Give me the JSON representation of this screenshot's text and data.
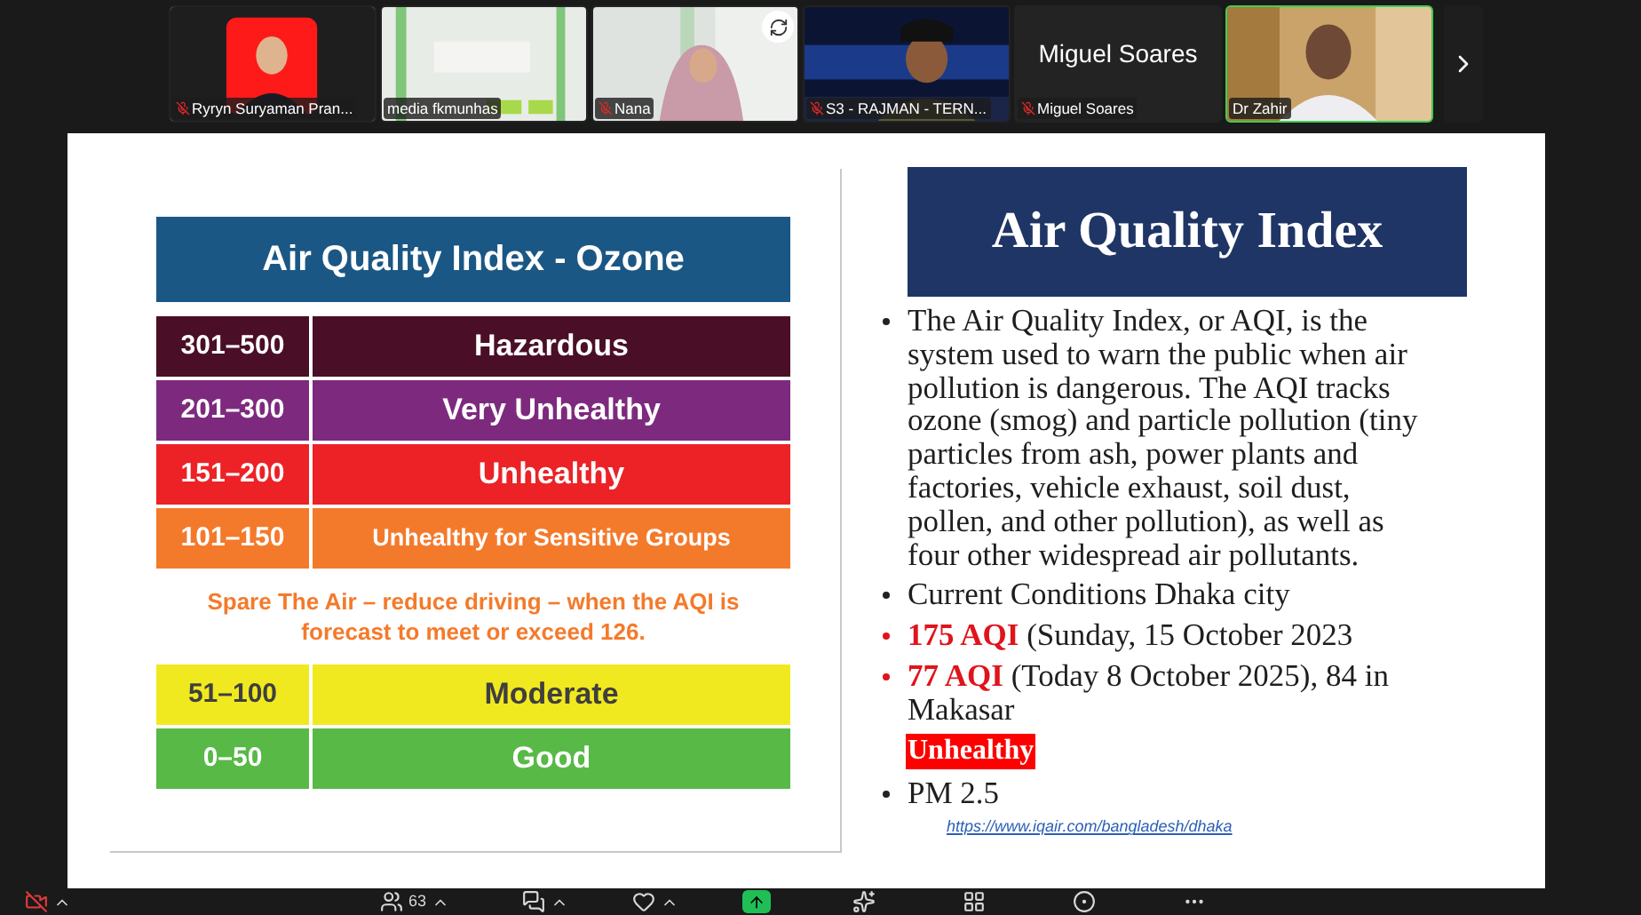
{
  "participants": [
    {
      "kind": "video",
      "name": "Ryryn Suryaman Pran...",
      "muted": true,
      "active": false
    },
    {
      "kind": "video",
      "name": "media fkmunhas",
      "muted": false,
      "active": false
    },
    {
      "kind": "video",
      "name": "Nana",
      "muted": true,
      "active": false
    },
    {
      "kind": "video",
      "name": "S3 - RAJMAN - TERN...",
      "muted": true,
      "active": false
    },
    {
      "kind": "name",
      "display_name": "Miguel Soares",
      "name": "Miguel Soares",
      "muted": true,
      "active": false
    },
    {
      "kind": "video",
      "name": "Dr Zahir",
      "muted": false,
      "active": true
    }
  ],
  "slide": {
    "aqi_table": {
      "title": "Air Quality Index - Ozone",
      "rows": [
        {
          "range": "301–500",
          "label": "Hazardous",
          "color": "#4a0f26"
        },
        {
          "range": "201–300",
          "label": "Very Unhealthy",
          "color": "#7d2a7e"
        },
        {
          "range": "151–200",
          "label": "Unhealthy",
          "color": "#ec2227"
        },
        {
          "range": "101–150",
          "label": "Unhealthy for Sensitive Groups",
          "color": "#f47a2b"
        }
      ],
      "note": "Spare The Air – reduce driving – when the AQI is forecast to meet or exceed 126.",
      "rows_after": [
        {
          "range": "51–100",
          "label": "Moderate",
          "color": "#f1e91f"
        },
        {
          "range": "0–50",
          "label": "Good",
          "color": "#58b947"
        }
      ]
    },
    "title": "Air Quality Index",
    "bullets": [
      {
        "text": "The Air Quality Index, or AQI, is the system used to warn the public when air pollution is dangerous. The AQI tracks ozone (smog) and particle pollution (tiny particles from ash, power plants and factories, vehicle exhaust, soil dust, pollen, and other pollution), as well as four other widespread air pollutants.",
        "alert": false
      },
      {
        "text": "Current Conditions Dhaka city",
        "alert": false
      },
      {
        "text": "**175 AQI** (Sunday, 15 October 2023",
        "alert": true
      },
      {
        "text": "**77 AQI** (Today 8 October 2025), 84 in Makasar",
        "alert": true
      }
    ],
    "status_tag": "Unhealthy",
    "bullets_after": [
      {
        "text": "PM 2.5",
        "alert": false
      }
    ],
    "link": "https://www.iqair.com/bangladesh/dhaka"
  },
  "toolbar": {
    "video_off": true,
    "participant_count": "63"
  }
}
